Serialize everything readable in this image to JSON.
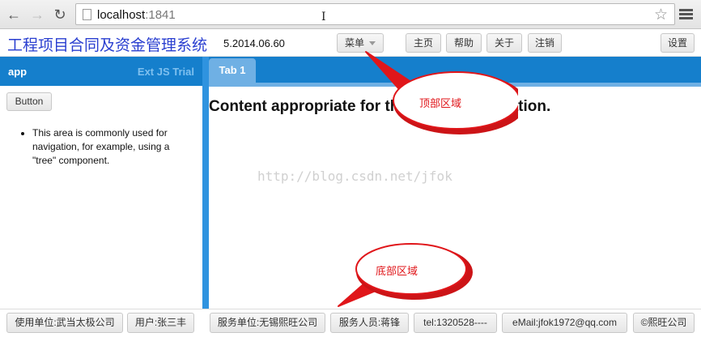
{
  "browser": {
    "url_host": "localhost",
    "url_port": ":1841"
  },
  "header": {
    "title": "工程项目合同及资金管理系统",
    "version": "5.2014.06.60",
    "menu_label": "菜单",
    "home_label": "主页",
    "help_label": "帮助",
    "about_label": "关于",
    "logout_label": "注销",
    "settings_label": "设置"
  },
  "west": {
    "title": "app",
    "trial": "Ext JS Trial",
    "button_label": "Button",
    "nav_text": "This area is commonly used for navigation, for example, using a \"tree\" component."
  },
  "center": {
    "tab_label": "Tab 1",
    "content_text": "Content appropriate for the current navigation."
  },
  "watermark": "http://blog.csdn.net/jfok",
  "footer": {
    "client_unit": "使用单位:武当太极公司",
    "user": "用户:张三丰",
    "service_unit": "服务单位:无锡熙旺公司",
    "service_person": "服务人员:蒋锋",
    "tel": "tel:1320528----",
    "email": "eMail:jfok1972@qq.com",
    "copyright": "©熙旺公司"
  },
  "annotations": {
    "top_label": "顶部区域",
    "bottom_label": "底部区域"
  },
  "colors": {
    "panel_header": "#157fcc",
    "tab_active": "#6fb0e4",
    "title_text": "#2a3fd0",
    "callout_red": "#e0161a"
  }
}
